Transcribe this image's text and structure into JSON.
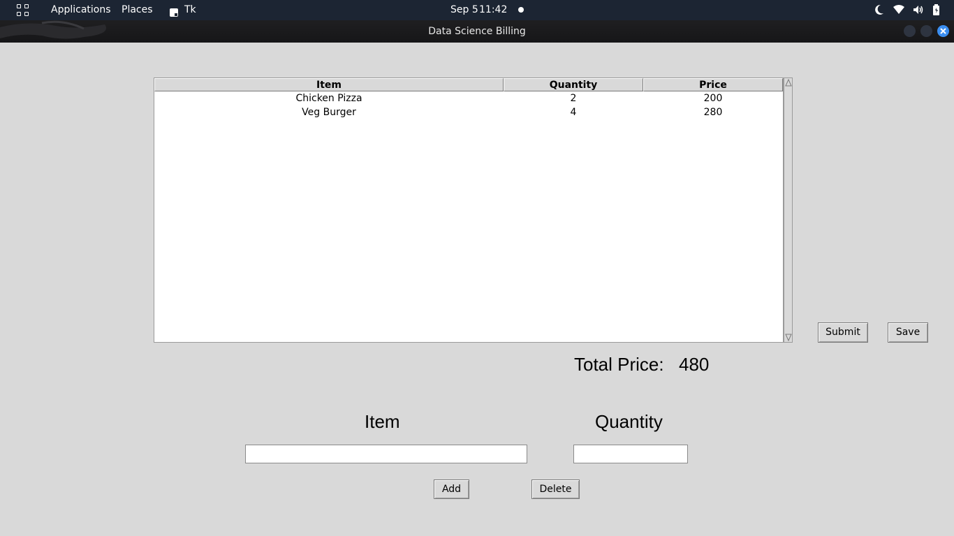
{
  "topbar": {
    "applications_label": "Applications",
    "places_label": "Places",
    "app_name": "Tk",
    "date": "Sep 5",
    "time": "11:42"
  },
  "window": {
    "title": "Data Science Billing"
  },
  "table": {
    "columns": [
      "Item",
      "Quantity",
      "Price"
    ],
    "rows": [
      [
        "Chicken Pizza",
        "2",
        "200"
      ],
      [
        "Veg Burger",
        "4",
        "280"
      ]
    ]
  },
  "buttons": {
    "submit": "Submit",
    "save": "Save",
    "add": "Add",
    "delete": "Delete"
  },
  "total": {
    "label": "Total Price:",
    "value": "480"
  },
  "form": {
    "item_label": "Item",
    "quantity_label": "Quantity",
    "item_value": "",
    "quantity_value": ""
  },
  "colors": {
    "panel_bg": "#1c2533",
    "window_bg": "#d9d9d9",
    "close_button": "#3b8ef0"
  }
}
